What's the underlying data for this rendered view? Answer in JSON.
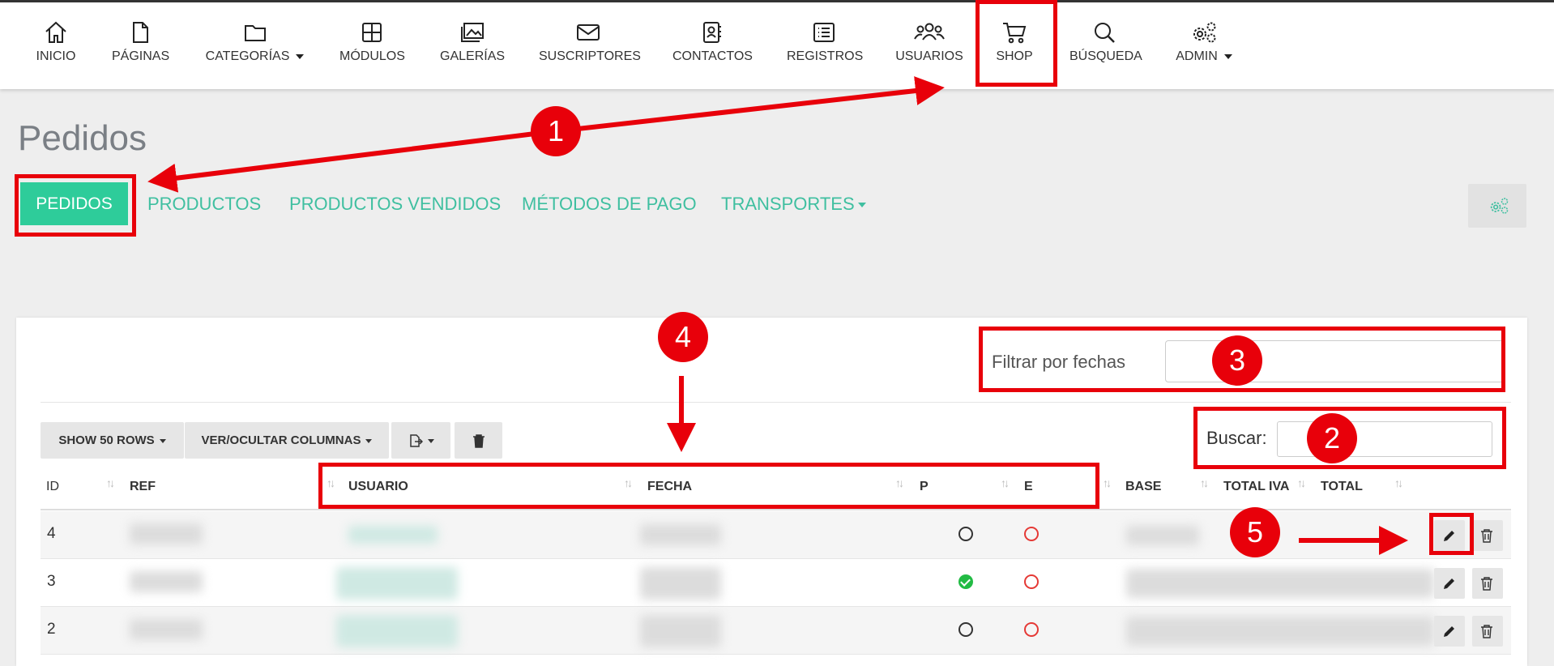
{
  "nav": {
    "items": [
      {
        "label": "INICIO",
        "icon": "home-icon"
      },
      {
        "label": "PÁGINAS",
        "icon": "page-icon"
      },
      {
        "label": "CATEGORÍAS",
        "icon": "folder-icon"
      },
      {
        "label": "MÓDULOS",
        "icon": "modules-icon"
      },
      {
        "label": "GALERÍAS",
        "icon": "gallery-icon"
      },
      {
        "label": "SUSCRIPTORES",
        "icon": "envelope-icon"
      },
      {
        "label": "CONTACTOS",
        "icon": "contact-book-icon"
      },
      {
        "label": "REGISTROS",
        "icon": "list-icon"
      },
      {
        "label": "USUARIOS",
        "icon": "users-icon"
      },
      {
        "label": "SHOP",
        "icon": "cart-icon"
      },
      {
        "label": "BÚSQUEDA",
        "icon": "search-icon"
      },
      {
        "label": "ADMIN",
        "icon": "gears-icon"
      }
    ]
  },
  "page": {
    "title": "Pedidos"
  },
  "tabs": [
    {
      "label": "PEDIDOS",
      "active": true
    },
    {
      "label": "PRODUCTOS"
    },
    {
      "label": "PRODUCTOS VENDIDOS"
    },
    {
      "label": "MÉTODOS DE PAGO"
    },
    {
      "label": "TRANSPORTES"
    }
  ],
  "filters": {
    "date_label": "Filtrar por fechas",
    "search_label": "Buscar:"
  },
  "toolbar": {
    "show_rows": "SHOW 50 ROWS",
    "columns": "VER/OCULTAR COLUMNAS"
  },
  "table": {
    "headers": [
      "ID",
      "REF",
      "USUARIO",
      "FECHA",
      "P",
      "E",
      "BASE",
      "TOTAL IVA",
      "TOTAL"
    ],
    "rows": [
      {
        "id": "4",
        "paid": false,
        "sent": false
      },
      {
        "id": "3",
        "paid": true,
        "sent": false
      },
      {
        "id": "2",
        "paid": false,
        "sent": false
      }
    ]
  },
  "annotations": [
    "1",
    "2",
    "3",
    "4",
    "5"
  ],
  "colors": {
    "accent": "#2ecc9a",
    "link": "#3fbfa0",
    "annotation": "#e8000a"
  }
}
